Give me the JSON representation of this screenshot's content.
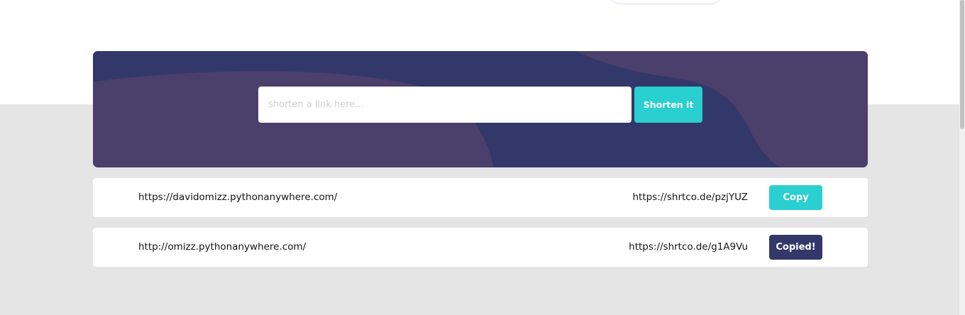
{
  "shortener": {
    "input_placeholder": "shorten a link here...",
    "input_value": "",
    "submit_label": "Shorten it"
  },
  "results": [
    {
      "original": "https://davidomizz.pythonanywhere.com/",
      "short": "https://shrtco.de/pzjYUZ",
      "button_label": "Copy",
      "button_state": "idle"
    },
    {
      "original": "http://omizz.pythonanywhere.com/",
      "short": "https://shrtco.de/g1A9Vu",
      "button_label": "Copied!",
      "button_state": "copied"
    }
  ],
  "colors": {
    "box_background": "#4b3f6b",
    "box_wave": "#33386a",
    "accent_cyan": "#2acfcf",
    "copied_dark": "#3b3054",
    "page_gray": "#e5e5e5"
  }
}
